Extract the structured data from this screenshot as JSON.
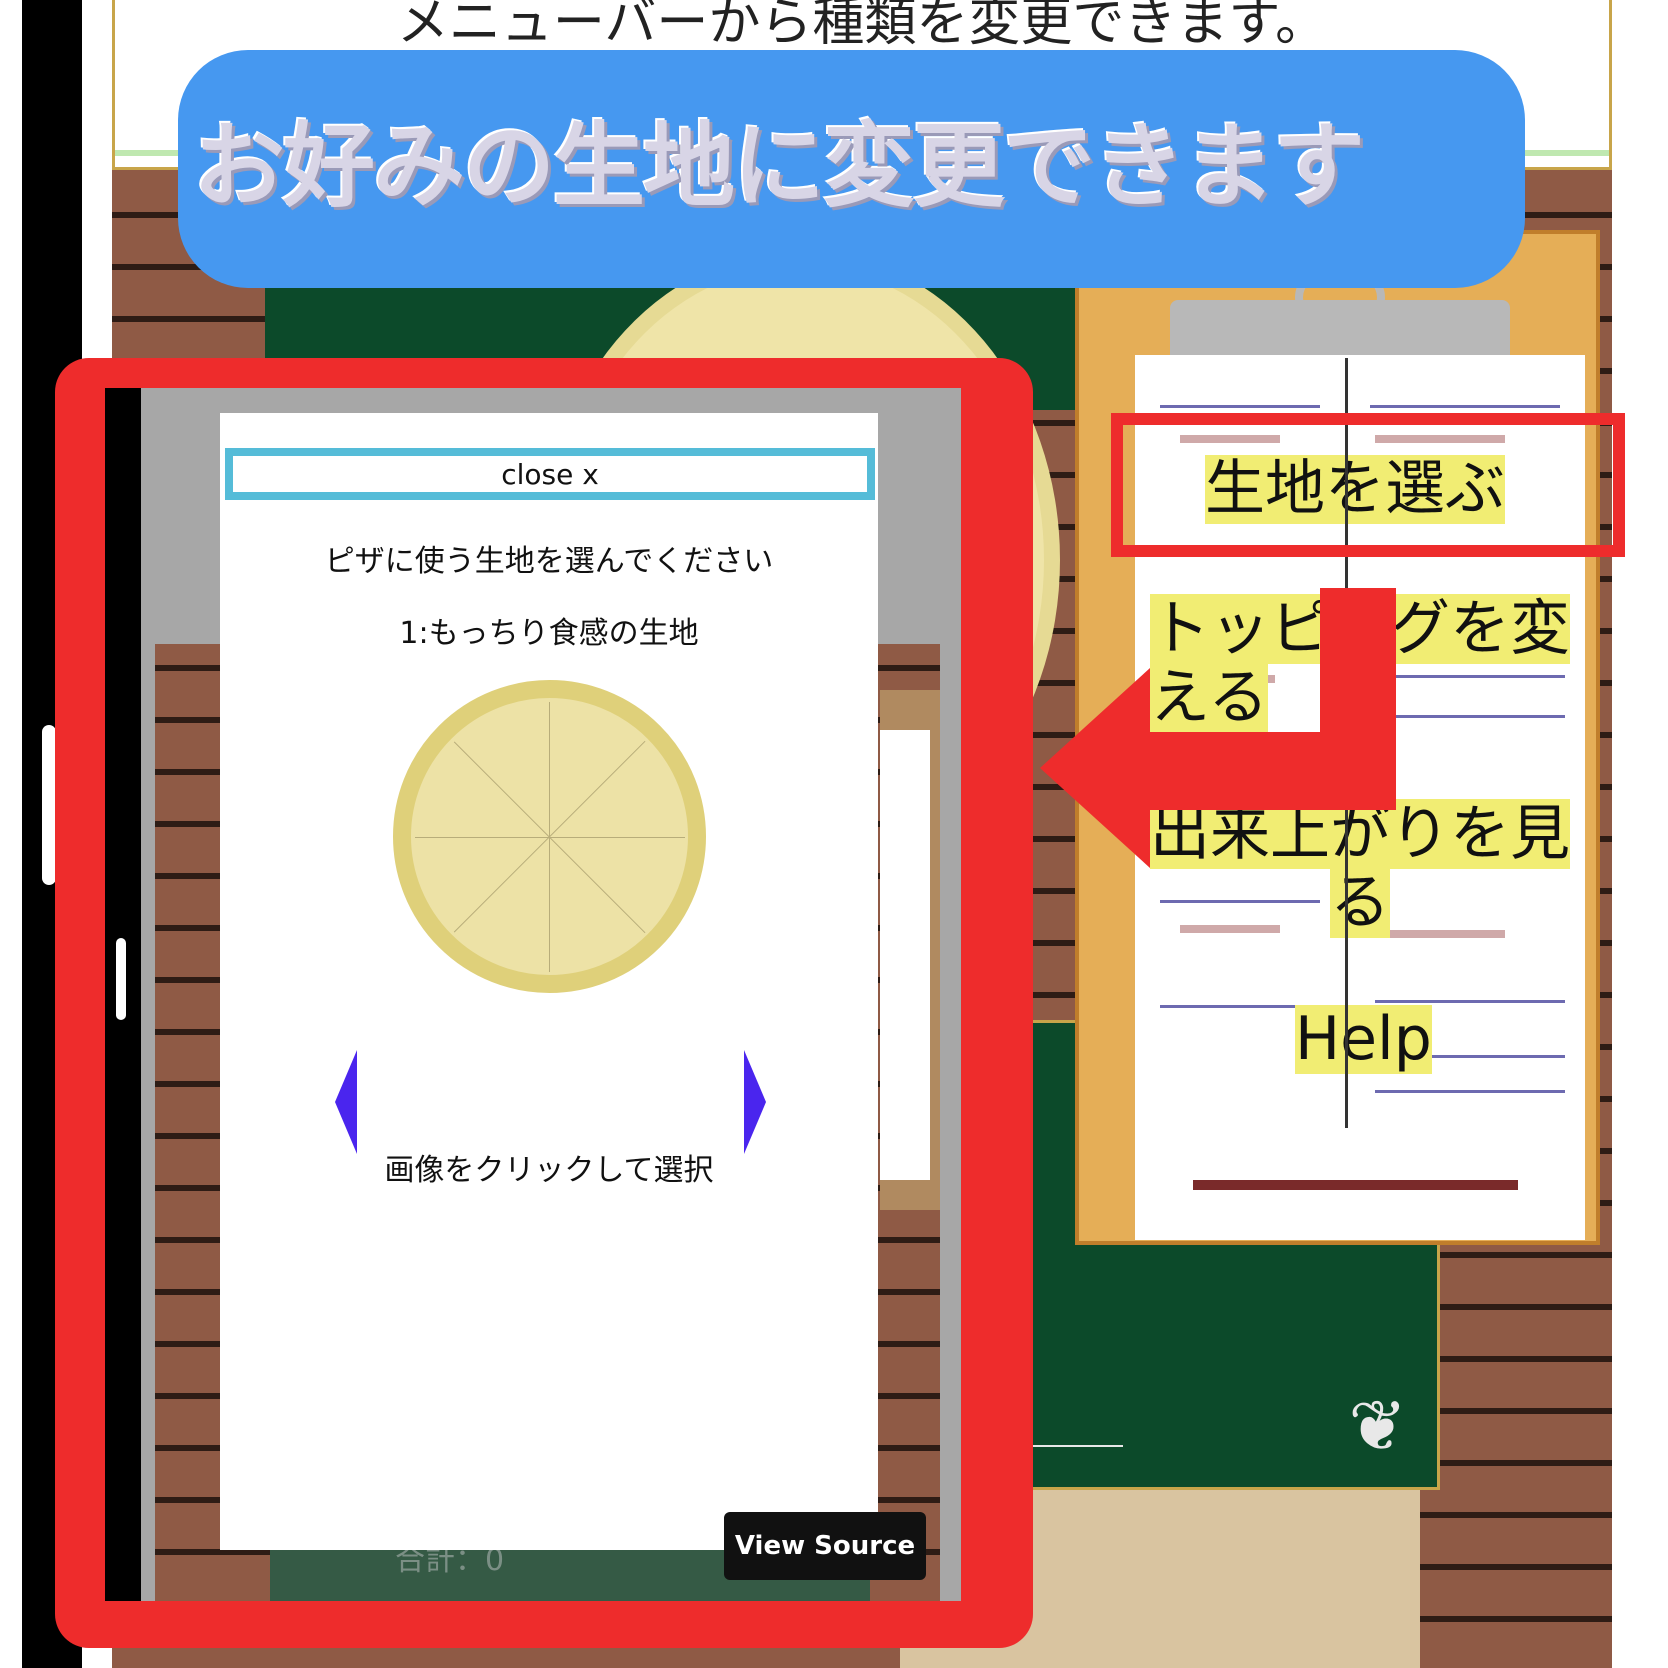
{
  "top_banner": {
    "text": "メニューバーから種類を変更できます。"
  },
  "callout": {
    "text": "お好みの生地に変更できます"
  },
  "menu": {
    "items": [
      {
        "label": "生地を選ぶ"
      },
      {
        "label": "トッピングを変える"
      },
      {
        "label": "出来上がりを見る"
      },
      {
        "label": "Help"
      }
    ]
  },
  "modal": {
    "close_label": "close x",
    "prompt": "ピザに使う生地を選んでください",
    "option_label": "1:もっちり食感の生地",
    "instruction": "画像をクリックして選択"
  },
  "app": {
    "total_label": "合計：0",
    "view_source_label": "View Source"
  },
  "colors": {
    "annotation_red": "#ee2c2c",
    "callout_blue": "#4698f0",
    "menu_highlight": "#f1ed73",
    "close_border": "#55bcd8",
    "nav_arrow": "#4a25ee"
  },
  "icons": {
    "prev": "triangle-left",
    "next": "triangle-right"
  }
}
